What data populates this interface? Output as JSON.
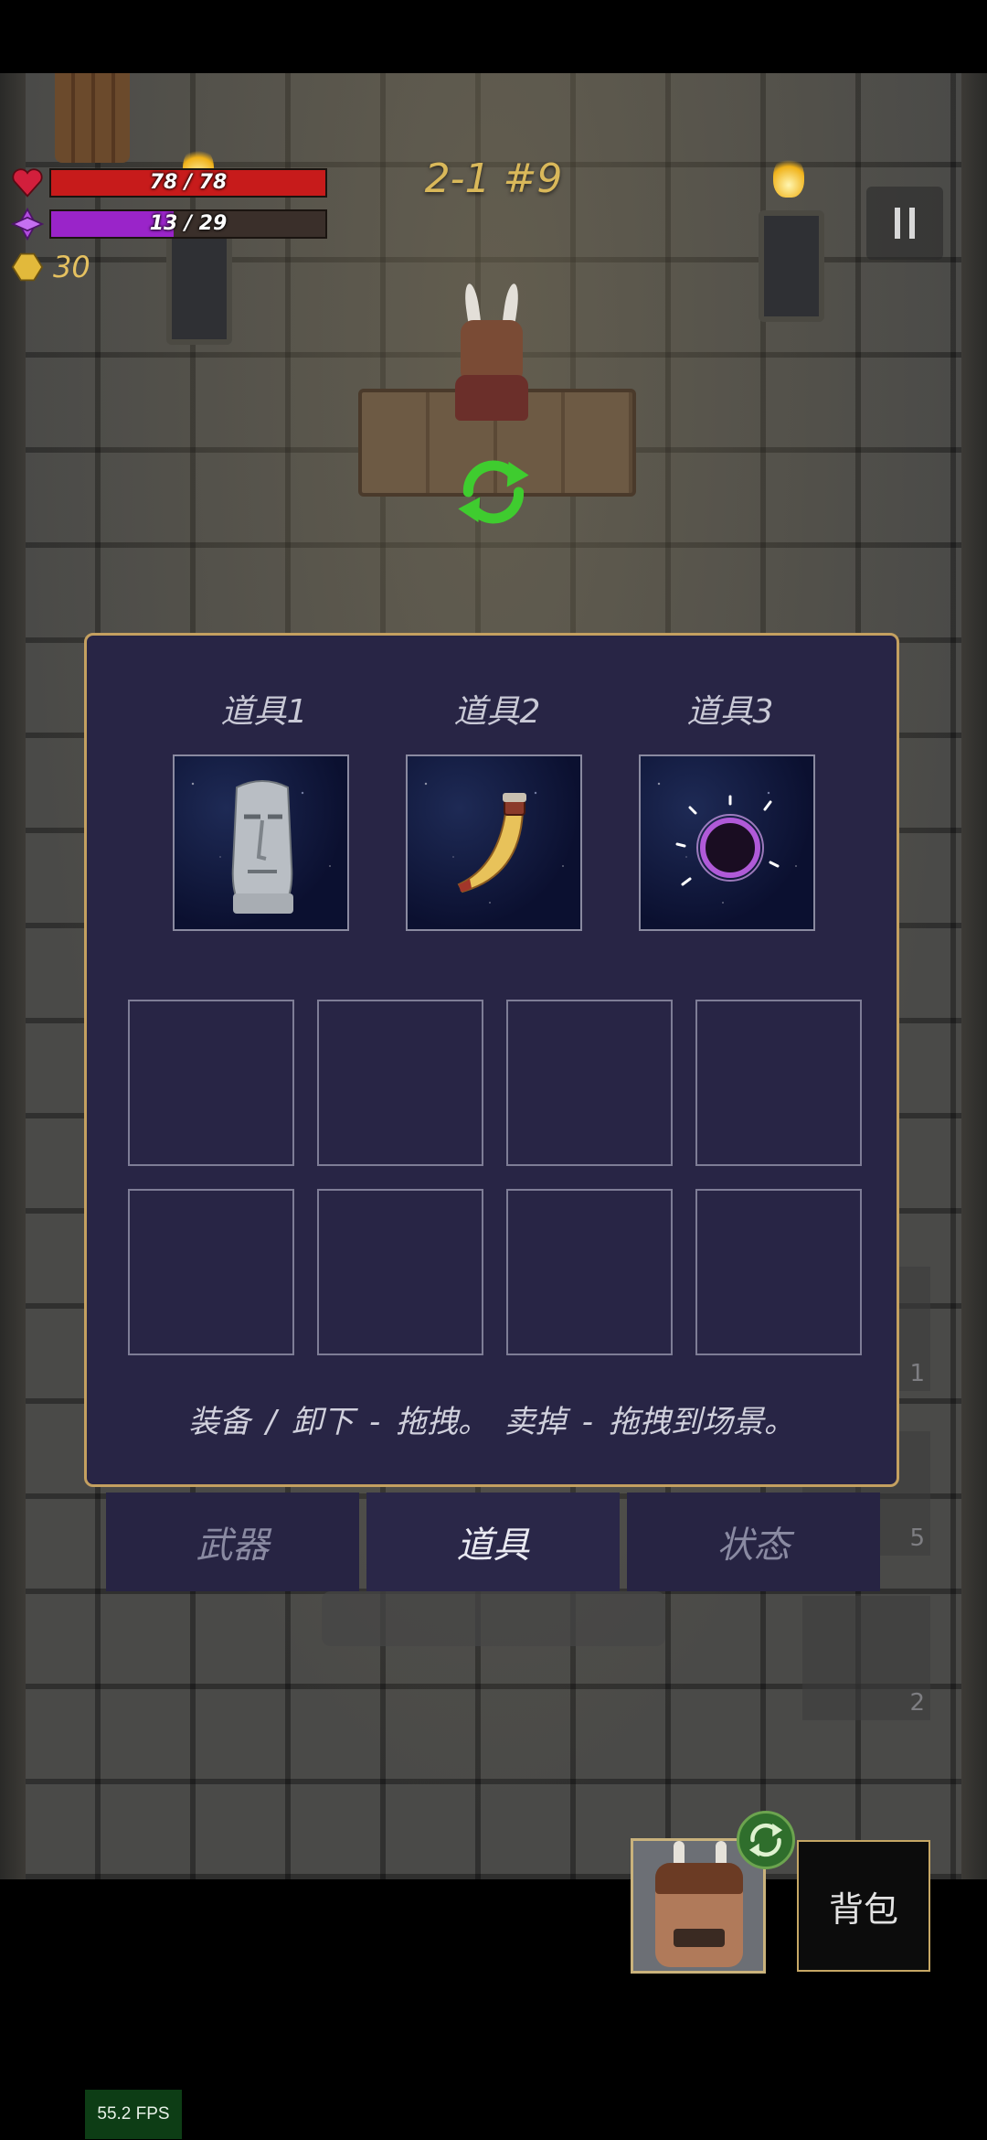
{
  "hud": {
    "hp": {
      "current": 78,
      "max": 78,
      "text": "78 / 78",
      "color": "#c71b1b"
    },
    "mana": {
      "current": 13,
      "max": 29,
      "text": "13 / 29",
      "color": "#9a24c9"
    },
    "gold": "30",
    "level": "2-1 #9",
    "icons": {
      "hp": "heart-icon",
      "mana": "mana-crystal-icon",
      "gold": "coin-icon",
      "pause": "pause-icon"
    }
  },
  "inventory": {
    "equip_slots": [
      {
        "title": "道具1",
        "item": "moai-statue",
        "icon": "moai-statue-icon"
      },
      {
        "title": "道具2",
        "item": "horn",
        "icon": "horn-icon"
      },
      {
        "title": "道具3",
        "item": "dark-portal",
        "icon": "dark-portal-icon"
      }
    ],
    "bag_slots": 8,
    "hint": "装备 / 卸下 - 拖拽。  卖掉 - 拖拽到场景。"
  },
  "tabs": [
    {
      "label": "武器",
      "active": false
    },
    {
      "label": "道具",
      "active": true
    },
    {
      "label": "状态",
      "active": false
    }
  ],
  "background_shop": [
    "1",
    "5",
    "2"
  ],
  "bottom": {
    "backpack_label": "背包",
    "swap_icon": "swap-refresh-icon"
  },
  "fps": "55.2 FPS",
  "colors": {
    "panel_bg": "#282545",
    "panel_border": "#c4a060",
    "level_text": "#d9b85a",
    "gold_text": "#e5c160"
  }
}
